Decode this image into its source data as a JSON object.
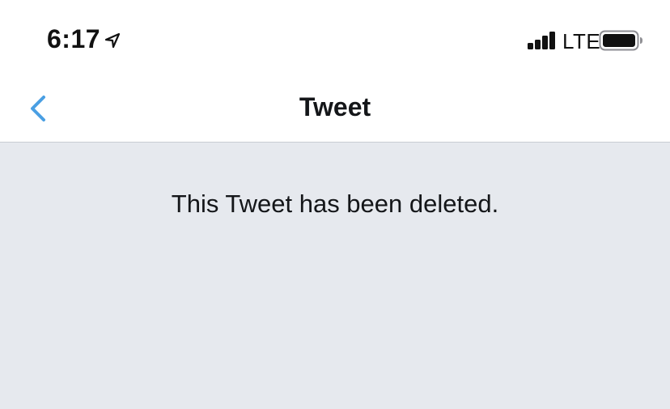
{
  "status_bar": {
    "time": "6:17",
    "network": "LTE",
    "location_icon": "location-arrow-icon",
    "signal_icon": "cellular-signal-icon",
    "battery_icon": "battery-icon"
  },
  "nav": {
    "back_icon": "chevron-left-icon",
    "title": "Tweet"
  },
  "content": {
    "message": "This Tweet has been deleted."
  },
  "colors": {
    "accent": "#4a9fe3",
    "background": "#e6e9ee",
    "header": "#ffffff",
    "text": "#141619"
  }
}
